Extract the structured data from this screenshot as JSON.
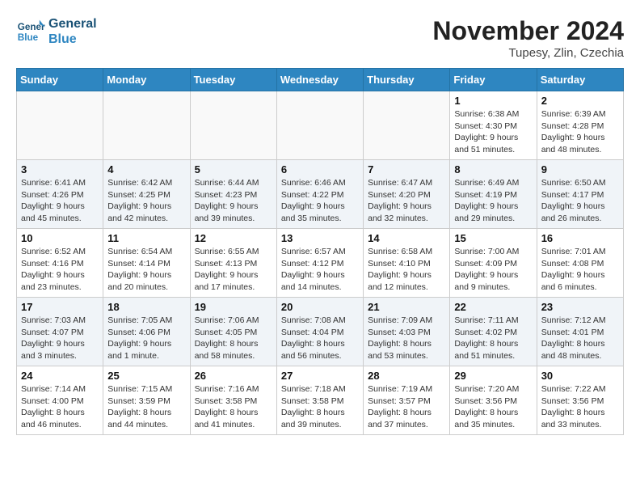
{
  "logo": {
    "line1": "General",
    "line2": "Blue"
  },
  "title": "November 2024",
  "location": "Tupesy, Zlin, Czechia",
  "days_of_week": [
    "Sunday",
    "Monday",
    "Tuesday",
    "Wednesday",
    "Thursday",
    "Friday",
    "Saturday"
  ],
  "weeks": [
    [
      {
        "day": "",
        "info": ""
      },
      {
        "day": "",
        "info": ""
      },
      {
        "day": "",
        "info": ""
      },
      {
        "day": "",
        "info": ""
      },
      {
        "day": "",
        "info": ""
      },
      {
        "day": "1",
        "info": "Sunrise: 6:38 AM\nSunset: 4:30 PM\nDaylight: 9 hours\nand 51 minutes."
      },
      {
        "day": "2",
        "info": "Sunrise: 6:39 AM\nSunset: 4:28 PM\nDaylight: 9 hours\nand 48 minutes."
      }
    ],
    [
      {
        "day": "3",
        "info": "Sunrise: 6:41 AM\nSunset: 4:26 PM\nDaylight: 9 hours\nand 45 minutes."
      },
      {
        "day": "4",
        "info": "Sunrise: 6:42 AM\nSunset: 4:25 PM\nDaylight: 9 hours\nand 42 minutes."
      },
      {
        "day": "5",
        "info": "Sunrise: 6:44 AM\nSunset: 4:23 PM\nDaylight: 9 hours\nand 39 minutes."
      },
      {
        "day": "6",
        "info": "Sunrise: 6:46 AM\nSunset: 4:22 PM\nDaylight: 9 hours\nand 35 minutes."
      },
      {
        "day": "7",
        "info": "Sunrise: 6:47 AM\nSunset: 4:20 PM\nDaylight: 9 hours\nand 32 minutes."
      },
      {
        "day": "8",
        "info": "Sunrise: 6:49 AM\nSunset: 4:19 PM\nDaylight: 9 hours\nand 29 minutes."
      },
      {
        "day": "9",
        "info": "Sunrise: 6:50 AM\nSunset: 4:17 PM\nDaylight: 9 hours\nand 26 minutes."
      }
    ],
    [
      {
        "day": "10",
        "info": "Sunrise: 6:52 AM\nSunset: 4:16 PM\nDaylight: 9 hours\nand 23 minutes."
      },
      {
        "day": "11",
        "info": "Sunrise: 6:54 AM\nSunset: 4:14 PM\nDaylight: 9 hours\nand 20 minutes."
      },
      {
        "day": "12",
        "info": "Sunrise: 6:55 AM\nSunset: 4:13 PM\nDaylight: 9 hours\nand 17 minutes."
      },
      {
        "day": "13",
        "info": "Sunrise: 6:57 AM\nSunset: 4:12 PM\nDaylight: 9 hours\nand 14 minutes."
      },
      {
        "day": "14",
        "info": "Sunrise: 6:58 AM\nSunset: 4:10 PM\nDaylight: 9 hours\nand 12 minutes."
      },
      {
        "day": "15",
        "info": "Sunrise: 7:00 AM\nSunset: 4:09 PM\nDaylight: 9 hours\nand 9 minutes."
      },
      {
        "day": "16",
        "info": "Sunrise: 7:01 AM\nSunset: 4:08 PM\nDaylight: 9 hours\nand 6 minutes."
      }
    ],
    [
      {
        "day": "17",
        "info": "Sunrise: 7:03 AM\nSunset: 4:07 PM\nDaylight: 9 hours\nand 3 minutes."
      },
      {
        "day": "18",
        "info": "Sunrise: 7:05 AM\nSunset: 4:06 PM\nDaylight: 9 hours\nand 1 minute."
      },
      {
        "day": "19",
        "info": "Sunrise: 7:06 AM\nSunset: 4:05 PM\nDaylight: 8 hours\nand 58 minutes."
      },
      {
        "day": "20",
        "info": "Sunrise: 7:08 AM\nSunset: 4:04 PM\nDaylight: 8 hours\nand 56 minutes."
      },
      {
        "day": "21",
        "info": "Sunrise: 7:09 AM\nSunset: 4:03 PM\nDaylight: 8 hours\nand 53 minutes."
      },
      {
        "day": "22",
        "info": "Sunrise: 7:11 AM\nSunset: 4:02 PM\nDaylight: 8 hours\nand 51 minutes."
      },
      {
        "day": "23",
        "info": "Sunrise: 7:12 AM\nSunset: 4:01 PM\nDaylight: 8 hours\nand 48 minutes."
      }
    ],
    [
      {
        "day": "24",
        "info": "Sunrise: 7:14 AM\nSunset: 4:00 PM\nDaylight: 8 hours\nand 46 minutes."
      },
      {
        "day": "25",
        "info": "Sunrise: 7:15 AM\nSunset: 3:59 PM\nDaylight: 8 hours\nand 44 minutes."
      },
      {
        "day": "26",
        "info": "Sunrise: 7:16 AM\nSunset: 3:58 PM\nDaylight: 8 hours\nand 41 minutes."
      },
      {
        "day": "27",
        "info": "Sunrise: 7:18 AM\nSunset: 3:58 PM\nDaylight: 8 hours\nand 39 minutes."
      },
      {
        "day": "28",
        "info": "Sunrise: 7:19 AM\nSunset: 3:57 PM\nDaylight: 8 hours\nand 37 minutes."
      },
      {
        "day": "29",
        "info": "Sunrise: 7:20 AM\nSunset: 3:56 PM\nDaylight: 8 hours\nand 35 minutes."
      },
      {
        "day": "30",
        "info": "Sunrise: 7:22 AM\nSunset: 3:56 PM\nDaylight: 8 hours\nand 33 minutes."
      }
    ]
  ]
}
